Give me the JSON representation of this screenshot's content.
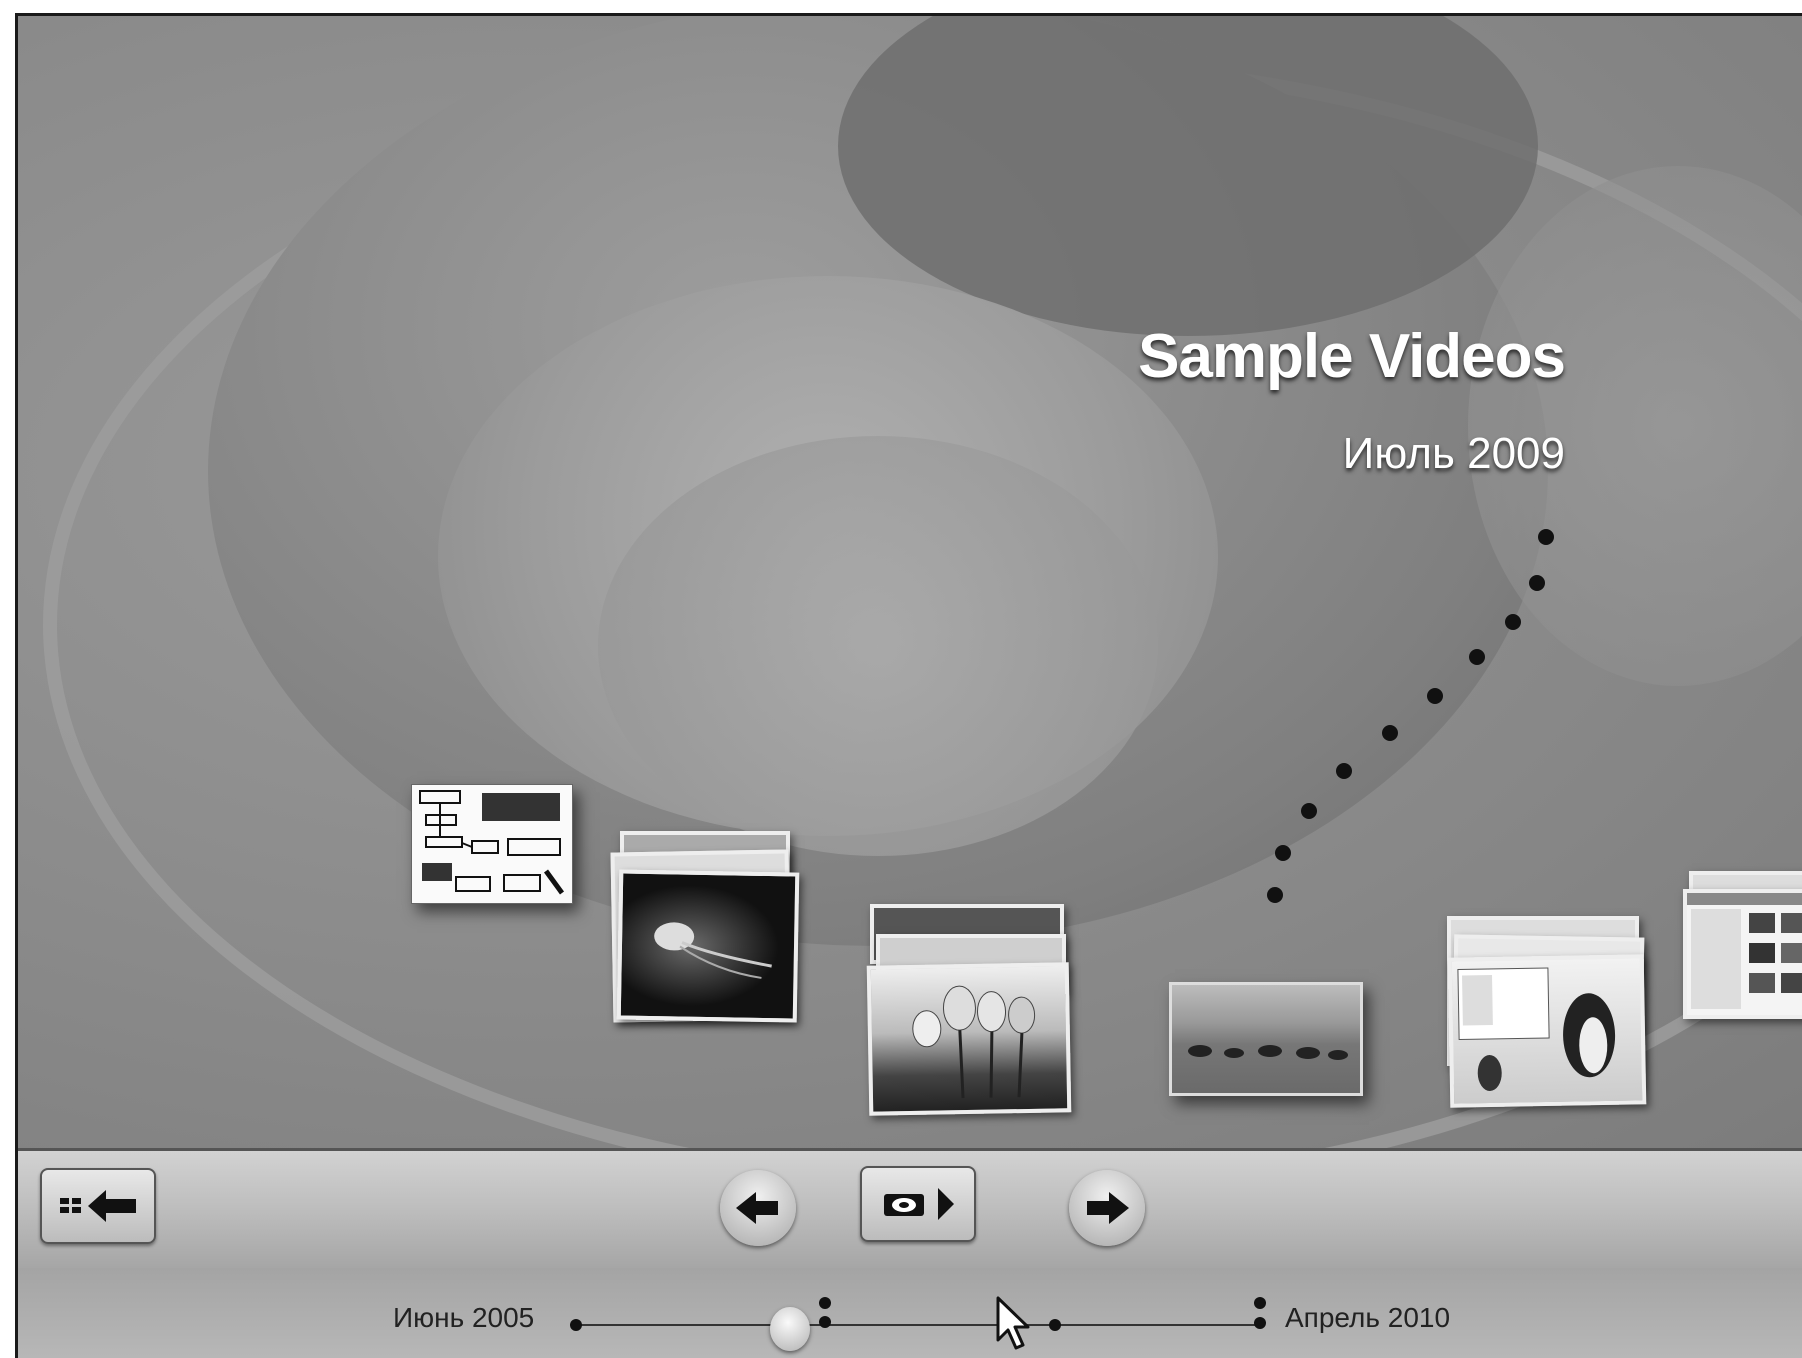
{
  "stage": {
    "title": "Sample Videos",
    "date": "Июль 2009"
  },
  "thumbnails": [
    {
      "name": "diagram-document"
    },
    {
      "name": "jellyfish"
    },
    {
      "name": "tulips"
    },
    {
      "name": "horses"
    },
    {
      "name": "penguins-screens"
    },
    {
      "name": "screens-stack"
    }
  ],
  "toolbar": {
    "grid_back_icon": "grid-back-icon",
    "prev_icon": "arrow-left-icon",
    "slideshow_icon": "slideshow-play-icon",
    "next_icon": "arrow-right-icon"
  },
  "timeline": {
    "start_label": "Июнь 2005",
    "end_label": "Апрель 2010"
  }
}
